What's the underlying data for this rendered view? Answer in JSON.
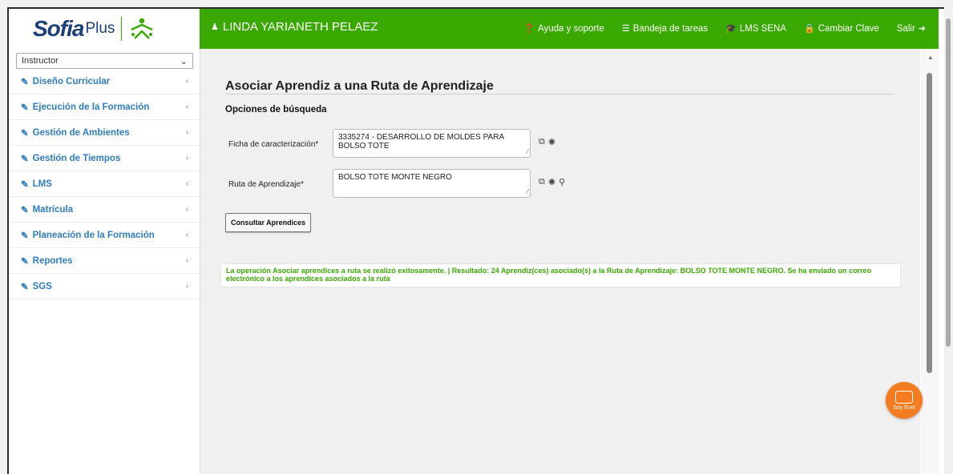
{
  "brand": {
    "sofia": "Sofia",
    "plus": "Plus",
    "sena": "SENA"
  },
  "header": {
    "user_name": "LINDA YARIANETH PELAEZ",
    "nav": [
      {
        "label": "Ayuda y soporte",
        "icon": "help-icon"
      },
      {
        "label": "Bandeja de tareas",
        "icon": "inbox-icon"
      },
      {
        "label": "LMS SENA",
        "icon": "graduation-cap-icon"
      },
      {
        "label": "Cambiar Clave",
        "icon": "lock-icon"
      },
      {
        "label": "Salir",
        "icon": "logout-icon"
      }
    ]
  },
  "sidebar": {
    "role": "Instructor",
    "items": [
      {
        "label": "Diseño Curricular"
      },
      {
        "label": "Ejecución de la Formación"
      },
      {
        "label": "Gestión de Ambientes"
      },
      {
        "label": "Gestión de Tiempos"
      },
      {
        "label": "LMS"
      },
      {
        "label": "Matrícula"
      },
      {
        "label": "Planeación de la Formación"
      },
      {
        "label": "Reportes"
      },
      {
        "label": "SGS"
      }
    ]
  },
  "main": {
    "title": "Asociar Aprendiz a una Ruta de Aprendizaje",
    "section": "Opciones de búsqueda",
    "ficha_label": "Ficha de caracterización*",
    "ficha_value": "3335274 - DESARROLLO DE MOLDES PARA BOLSO TOTE",
    "ruta_label": "Ruta de Aprendizaje*",
    "ruta_value": "BOLSO TOTE MONTE NEGRO",
    "button": "Consultar Aprendices",
    "message": "La operación Asociar aprendices a ruta se realizó exitosamente. | Resultado: 24 Aprendiz(ces) asociado(s) a la Ruta de Aprendizaje: BOLSO TOTE MONTE NEGRO. Se ha enviado un correo electrónico a los aprendices asociados a la ruta"
  },
  "fab": {
    "label": "Soy Evel"
  },
  "colors": {
    "green": "#39a900",
    "link_blue": "#2f7cc1",
    "orange": "#f47b20"
  }
}
